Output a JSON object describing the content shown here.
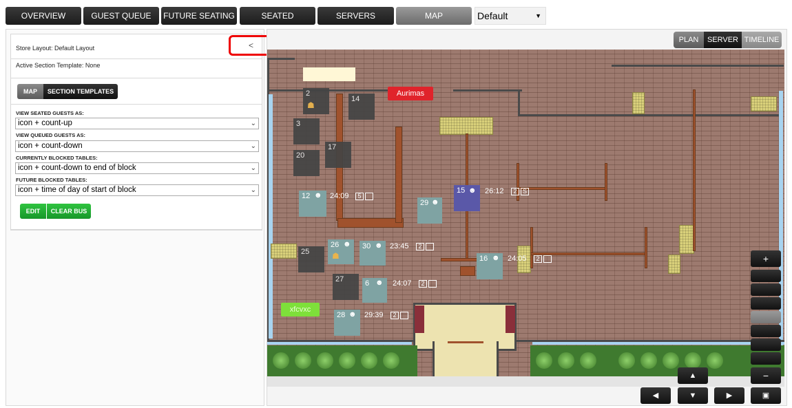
{
  "top_tabs": [
    {
      "label": "OVERVIEW"
    },
    {
      "label": "GUEST QUEUE"
    },
    {
      "label": "FUTURE SEATING"
    },
    {
      "label": "SEATED"
    },
    {
      "label": "SERVERS"
    },
    {
      "label": "MAP"
    }
  ],
  "layout_select": {
    "value": "Default"
  },
  "left_panel": {
    "store_layout": "Store Layout: Default Layout",
    "active_section": "Active Section Template: None",
    "collapse_label": "<",
    "tabs": {
      "map": "MAP",
      "section_templates": "SECTION TEMPLATES"
    },
    "fields": [
      {
        "label": "VIEW SEATED GUESTS AS:",
        "value": "icon + count-up"
      },
      {
        "label": "VIEW QUEUED GUESTS AS:",
        "value": "icon + count-down"
      },
      {
        "label": "CURRENTLY BLOCKED TABLES:",
        "value": "icon + count-down to end of block"
      },
      {
        "label": "FUTURE BLOCKED TABLES:",
        "value": "icon + time of day of start of block"
      }
    ],
    "buttons": {
      "edit": "EDIT",
      "clear_bus": "CLEAR BUS"
    }
  },
  "view_tabs": {
    "plan": "PLAN",
    "server": "SERVER",
    "timeline": "TIMELINE"
  },
  "map": {
    "server_tags": [
      {
        "name": "Aurimas",
        "color": "#e0232b"
      },
      {
        "name": "xfcvxc",
        "color": "#7ee03a"
      }
    ],
    "tables": [
      {
        "id": "2",
        "status": "dark"
      },
      {
        "id": "14",
        "status": "dark"
      },
      {
        "id": "3",
        "status": "dark"
      },
      {
        "id": "17",
        "status": "dark"
      },
      {
        "id": "20",
        "status": "dark"
      },
      {
        "id": "12",
        "status": "teal",
        "timer": "24:09",
        "party": "5"
      },
      {
        "id": "15",
        "status": "blue",
        "timer": "26:12",
        "party": "2",
        "flag": "S"
      },
      {
        "id": "29",
        "status": "teal"
      },
      {
        "id": "26",
        "status": "teal"
      },
      {
        "id": "30",
        "status": "teal",
        "timer": "23:45",
        "party": "2"
      },
      {
        "id": "25",
        "status": "dark"
      },
      {
        "id": "16",
        "status": "teal",
        "timer": "24:05",
        "party": "2"
      },
      {
        "id": "27",
        "status": "dark"
      },
      {
        "id": "6",
        "status": "teal",
        "timer": "24:07",
        "party": "2"
      },
      {
        "id": "28",
        "status": "teal",
        "timer": "29:39",
        "party": "2"
      }
    ]
  },
  "controls": {
    "zoom_in": "+",
    "zoom_out": "−",
    "up": "▲",
    "down": "▼",
    "left": "◀",
    "right": "▶",
    "center": "▣"
  }
}
